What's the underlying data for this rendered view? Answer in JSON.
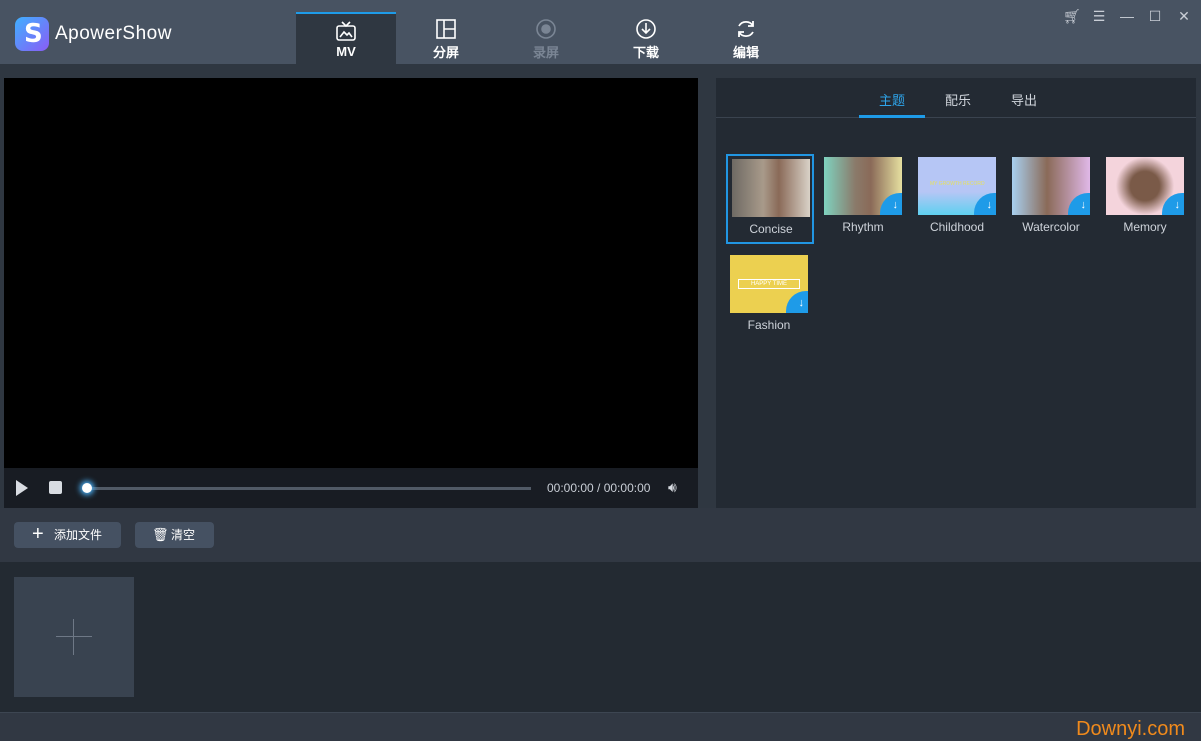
{
  "app": {
    "title": "ApowerShow"
  },
  "nav": [
    {
      "label": "MV",
      "icon": "tv-icon",
      "active": true
    },
    {
      "label": "分屏",
      "icon": "split-screen-icon"
    },
    {
      "label": "录屏",
      "icon": "record-icon",
      "disabled": true
    },
    {
      "label": "下载",
      "icon": "download-icon"
    },
    {
      "label": "编辑",
      "icon": "refresh-icon"
    }
  ],
  "window_controls": [
    "cart-icon",
    "menu-icon",
    "minimize-icon",
    "maximize-icon",
    "close-icon"
  ],
  "player": {
    "time": "00:00:00 / 00:00:00",
    "progress": 0
  },
  "right_tabs": [
    {
      "label": "主题",
      "active": true
    },
    {
      "label": "配乐"
    },
    {
      "label": "导出"
    }
  ],
  "themes": [
    {
      "label": "Concise",
      "selected": true,
      "download": false
    },
    {
      "label": "Rhythm",
      "download": true
    },
    {
      "label": "Childhood",
      "download": true,
      "thumb_text": "MY GROWTH RECORD"
    },
    {
      "label": "Watercolor",
      "download": true
    },
    {
      "label": "Memory",
      "download": true
    },
    {
      "label": "Fashion",
      "download": true,
      "thumb_text": "HAPPY TIME"
    }
  ],
  "toolbar": {
    "add_files": "添加文件",
    "clear": "清空"
  },
  "watermark": "Downyi.com",
  "colors": {
    "accent": "#1e9be8",
    "titlebar": "#485362",
    "watermark": "#f08a1c"
  }
}
